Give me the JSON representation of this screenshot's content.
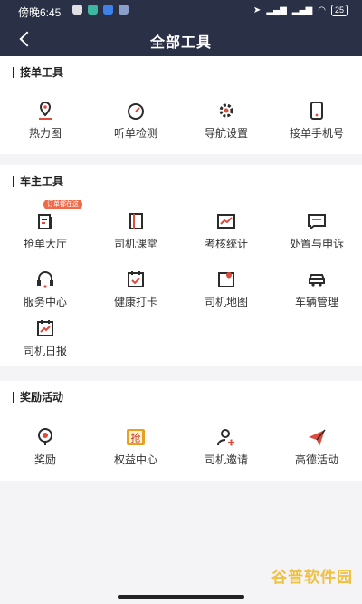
{
  "status": {
    "time": "傍晚6:45",
    "battery": "25"
  },
  "header": {
    "title": "全部工具"
  },
  "sections": [
    {
      "title": "接单工具",
      "items": [
        {
          "label": "热力图",
          "icon": "heatmap-pin-icon"
        },
        {
          "label": "听单检测",
          "icon": "gauge-icon"
        },
        {
          "label": "导航设置",
          "icon": "gear-icon"
        },
        {
          "label": "接单手机号",
          "icon": "phone-icon"
        }
      ]
    },
    {
      "title": "车主工具",
      "badge": "订单都在这",
      "items": [
        {
          "label": "抢单大厅",
          "icon": "order-list-icon"
        },
        {
          "label": "司机课堂",
          "icon": "book-icon"
        },
        {
          "label": "考核统计",
          "icon": "chart-icon"
        },
        {
          "label": "处置与申诉",
          "icon": "message-icon"
        },
        {
          "label": "服务中心",
          "icon": "headset-icon"
        },
        {
          "label": "健康打卡",
          "icon": "calendar-check-icon"
        },
        {
          "label": "司机地图",
          "icon": "map-icon"
        },
        {
          "label": "车辆管理",
          "icon": "car-icon"
        },
        {
          "label": "司机日报",
          "icon": "report-icon"
        }
      ]
    },
    {
      "title": "奖励活动",
      "items": [
        {
          "label": "奖励",
          "icon": "reward-icon"
        },
        {
          "label": "权益中心",
          "icon": "rights-icon",
          "icon_text": "抢"
        },
        {
          "label": "司机邀请",
          "icon": "invite-icon"
        },
        {
          "label": "高德活动",
          "icon": "paper-plane-icon"
        }
      ]
    }
  ],
  "watermark": "谷普软件园",
  "colors": {
    "header": "#2a3045",
    "accent": "#e04a3a",
    "icon": "#2b2b2b"
  }
}
